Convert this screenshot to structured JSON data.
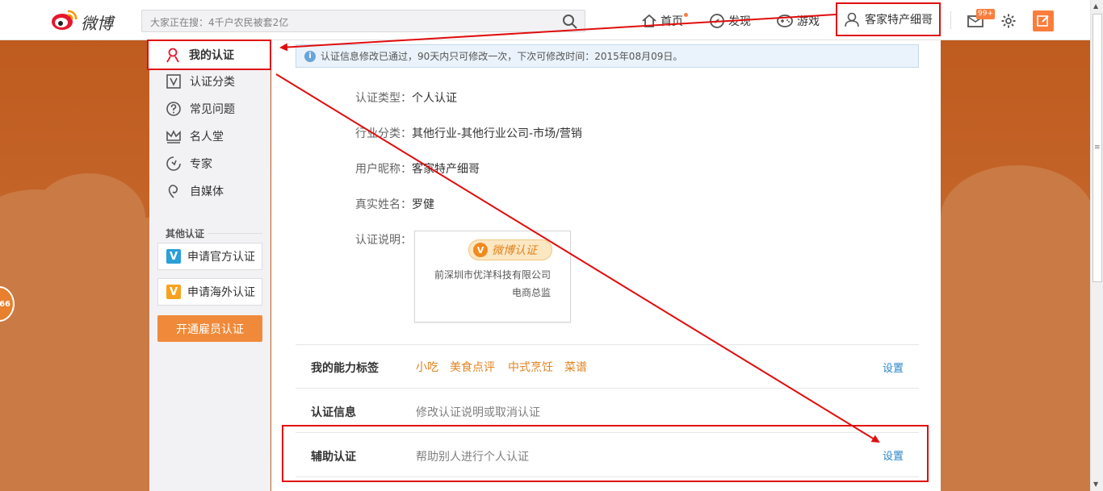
{
  "app": {
    "logo_text": "微博"
  },
  "search": {
    "placeholder": "大家正在搜：4千户农民被套2亿"
  },
  "nav": {
    "home": "首页",
    "discover": "发现",
    "games": "游戏",
    "username": "客家特产细哥",
    "message_badge": "99+"
  },
  "sidebar": {
    "items": [
      {
        "label": "我的认证",
        "icon": "person-icon"
      },
      {
        "label": "认证分类",
        "icon": "v-box-icon"
      },
      {
        "label": "常见问题",
        "icon": "question-icon"
      },
      {
        "label": "名人堂",
        "icon": "crown-icon"
      },
      {
        "label": "专家",
        "icon": "expert-icon"
      },
      {
        "label": "自媒体",
        "icon": "media-icon"
      }
    ],
    "other_title": "其他认证",
    "btn_official": "申请官方认证",
    "btn_overseas": "申请海外认证",
    "btn_employee": "开通雇员认证"
  },
  "notice": {
    "text": "认证信息修改已通过，90天内只可修改一次，下次可修改时间：2015年08月09日。"
  },
  "info": {
    "type_label": "认证类型：",
    "type_value": "个人认证",
    "industry_label": "行业分类：",
    "industry_value": "其他行业-其他行业公司-市场/营销",
    "nick_label": "用户昵称：",
    "nick_value": "客家特产细哥",
    "name_label": "真实姓名：",
    "name_value": "罗健",
    "desc_label": "认证说明：",
    "card_badge": "微博认证",
    "card_v": "V",
    "card_line1": "前深圳市优洋科技有限公司",
    "card_line2": "电商总监"
  },
  "rows": {
    "skills_title": "我的能力标签",
    "skills_tags": [
      "小吃",
      "美食点评",
      "中式烹饪",
      "菜谱"
    ],
    "skills_link": "设置",
    "cert_title": "认证信息",
    "cert_desc": "修改认证说明或取消认证",
    "assist_title": "辅助认证",
    "assist_desc": "帮助别人进行个人认证",
    "assist_link": "设置"
  },
  "float": {
    "coin_text": "66"
  },
  "colors": {
    "accent": "#fa7d3c",
    "annotation_red": "#e10d0d",
    "link": "#2a86c8",
    "tag": "#e1831f"
  }
}
